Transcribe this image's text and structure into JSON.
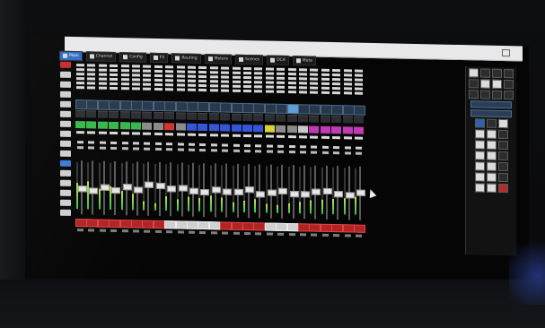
{
  "window": {
    "title": ""
  },
  "toolbar": {
    "tabs": [
      {
        "label": "Main",
        "active": true
      },
      {
        "label": "Channel",
        "active": false
      },
      {
        "label": "Config",
        "active": false
      },
      {
        "label": "FX",
        "active": false
      },
      {
        "label": "Routing",
        "active": false
      },
      {
        "label": "Meters",
        "active": false
      },
      {
        "label": "Scenes",
        "active": false
      },
      {
        "label": "DCA",
        "active": false
      },
      {
        "label": "Mute",
        "active": false
      }
    ]
  },
  "channels": [
    {
      "color": "#35b84a",
      "mute": true,
      "level": 0.55,
      "fader": 0.5,
      "insert_hl": false
    },
    {
      "color": "#35b84a",
      "mute": true,
      "level": 0.6,
      "fader": 0.45,
      "insert_hl": false
    },
    {
      "color": "#35b84a",
      "mute": true,
      "level": 0.45,
      "fader": 0.52,
      "insert_hl": false
    },
    {
      "color": "#35b84a",
      "mute": true,
      "level": 0.5,
      "fader": 0.48,
      "insert_hl": false
    },
    {
      "color": "#35b84a",
      "mute": true,
      "level": 0.4,
      "fader": 0.55,
      "insert_hl": false
    },
    {
      "color": "#35b84a",
      "mute": true,
      "level": 0.35,
      "fader": 0.5,
      "insert_hl": false
    },
    {
      "color": "#8a8a8a",
      "mute": true,
      "level": 0.2,
      "fader": 0.6,
      "insert_hl": false
    },
    {
      "color": "#8a8a8a",
      "mute": true,
      "level": 0.15,
      "fader": 0.58,
      "insert_hl": false
    },
    {
      "color": "#d23333",
      "mute": false,
      "level": 0.3,
      "fader": 0.52,
      "insert_hl": false
    },
    {
      "color": "#8a8a8a",
      "mute": false,
      "level": 0.25,
      "fader": 0.55,
      "insert_hl": false
    },
    {
      "color": "#3356d6",
      "mute": false,
      "level": 0.3,
      "fader": 0.5,
      "insert_hl": false
    },
    {
      "color": "#3356d6",
      "mute": false,
      "level": 0.28,
      "fader": 0.47,
      "insert_hl": false
    },
    {
      "color": "#3356d6",
      "mute": false,
      "level": 0.35,
      "fader": 0.53,
      "insert_hl": false
    },
    {
      "color": "#3356d6",
      "mute": true,
      "level": 0.3,
      "fader": 0.49,
      "insert_hl": false
    },
    {
      "color": "#3356d6",
      "mute": true,
      "level": 0.22,
      "fader": 0.5,
      "insert_hl": false
    },
    {
      "color": "#3356d6",
      "mute": true,
      "level": 0.25,
      "fader": 0.55,
      "insert_hl": false
    },
    {
      "color": "#3356d6",
      "mute": true,
      "level": 0.28,
      "fader": 0.45,
      "insert_hl": false
    },
    {
      "color": "#d9d23a",
      "mute": false,
      "level": 0.2,
      "fader": 0.5,
      "insert_hl": false
    },
    {
      "color": "#8a8a8a",
      "mute": false,
      "level": 0.18,
      "fader": 0.52,
      "insert_hl": false
    },
    {
      "color": "#8a8a8a",
      "mute": false,
      "level": 0.22,
      "fader": 0.48,
      "insert_hl": true
    },
    {
      "color": "#c8c8c8",
      "mute": true,
      "level": 0.25,
      "fader": 0.47,
      "insert_hl": false
    },
    {
      "color": "#c23ab8",
      "mute": true,
      "level": 0.28,
      "fader": 0.52,
      "insert_hl": false
    },
    {
      "color": "#c23ab8",
      "mute": true,
      "level": 0.3,
      "fader": 0.55,
      "insert_hl": false
    },
    {
      "color": "#c23ab8",
      "mute": true,
      "level": 0.32,
      "fader": 0.5,
      "insert_hl": false
    },
    {
      "color": "#c23ab8",
      "mute": true,
      "level": 0.35,
      "fader": 0.48,
      "insert_hl": false
    },
    {
      "color": "#c23ab8",
      "mute": true,
      "level": 0.38,
      "fader": 0.53,
      "insert_hl": false
    }
  ],
  "right_panel": {
    "label_a": "",
    "label_b": ""
  },
  "colors": {
    "accent": "#2b6cc4",
    "mute_red": "#b02424"
  }
}
